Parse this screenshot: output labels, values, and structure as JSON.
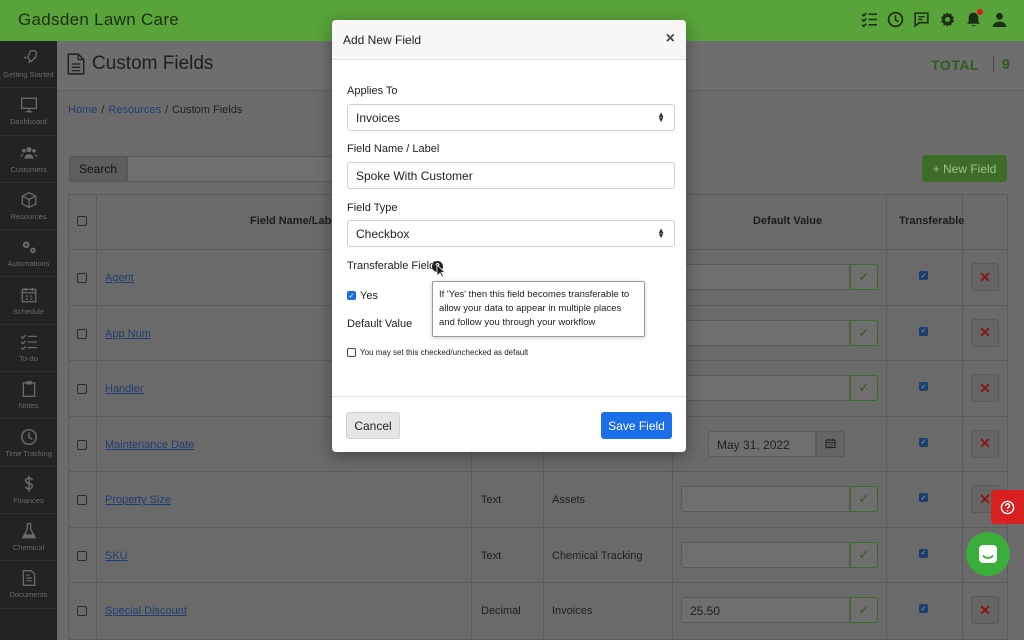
{
  "app": {
    "title": "Gadsden Lawn Care"
  },
  "sidebar": {
    "items": [
      {
        "label": "Getting Started",
        "icon": "rocket-icon"
      },
      {
        "label": "Dashboard",
        "icon": "monitor-icon"
      },
      {
        "label": "Customers",
        "icon": "users-icon"
      },
      {
        "label": "Resources",
        "icon": "cube-icon"
      },
      {
        "label": "Automations",
        "icon": "gears-icon"
      },
      {
        "label": "Schedule",
        "icon": "calendar-icon"
      },
      {
        "label": "To-do",
        "icon": "list-check-icon"
      },
      {
        "label": "Notes",
        "icon": "clipboard-icon"
      },
      {
        "label": "Time Tracking",
        "icon": "clock-icon"
      },
      {
        "label": "Finances",
        "icon": "dollar-icon"
      },
      {
        "label": "Chemical",
        "icon": "flask-icon"
      },
      {
        "label": "Documents",
        "icon": "document-icon"
      }
    ]
  },
  "page": {
    "title": "Custom Fields",
    "total_label": "TOTAL",
    "total_value": "9",
    "breadcrumb": [
      "Home",
      "Resources",
      "Custom Fields"
    ],
    "breadcrumb_sep": "/",
    "search_label": "Search",
    "new_field_label": "+ New Field"
  },
  "table": {
    "headers": {
      "name": "Field Name/Label",
      "default": "Default Value",
      "transferable": "Transferable"
    },
    "rows": [
      {
        "name": "Agent",
        "type": "",
        "applies": "",
        "value": "",
        "kind": "text"
      },
      {
        "name": "App Num",
        "type": "",
        "applies": "",
        "value": "",
        "kind": "text"
      },
      {
        "name": "Handler",
        "type": "",
        "applies": "",
        "value": "",
        "kind": "text"
      },
      {
        "name": "Maintenance Date",
        "type": "",
        "applies": "",
        "value": "May 31, 2022",
        "kind": "date"
      },
      {
        "name": "Property Size",
        "type": "Text",
        "applies": "Assets",
        "value": "",
        "kind": "text"
      },
      {
        "name": "SKU",
        "type": "Text",
        "applies": "Chemical Tracking",
        "value": "",
        "kind": "text"
      },
      {
        "name": "Special Discount",
        "type": "Decimal",
        "applies": "Invoices",
        "value": "25.50",
        "kind": "text"
      }
    ]
  },
  "modal": {
    "title": "Add New Field",
    "close": "×",
    "applies_to_label": "Applies To",
    "applies_to_value": "Invoices",
    "field_name_label": "Field Name / Label",
    "field_name_value": "Spoke With Customer",
    "field_type_label": "Field Type",
    "field_type_value": "Checkbox",
    "transferable_label": "Transferable Field",
    "yes_label": "Yes",
    "default_value_label": "Default Value",
    "tooltip": "If 'Yes' then this field becomes transferable to allow your data to appear in multiple places and follow you through your workflow",
    "default_note": "You may set this checked/unchecked as default",
    "cancel_label": "Cancel",
    "save_label": "Save Field"
  },
  "colors": {
    "topbar": "#58a33a",
    "primary": "#1a6fe8",
    "danger": "#d92020"
  }
}
